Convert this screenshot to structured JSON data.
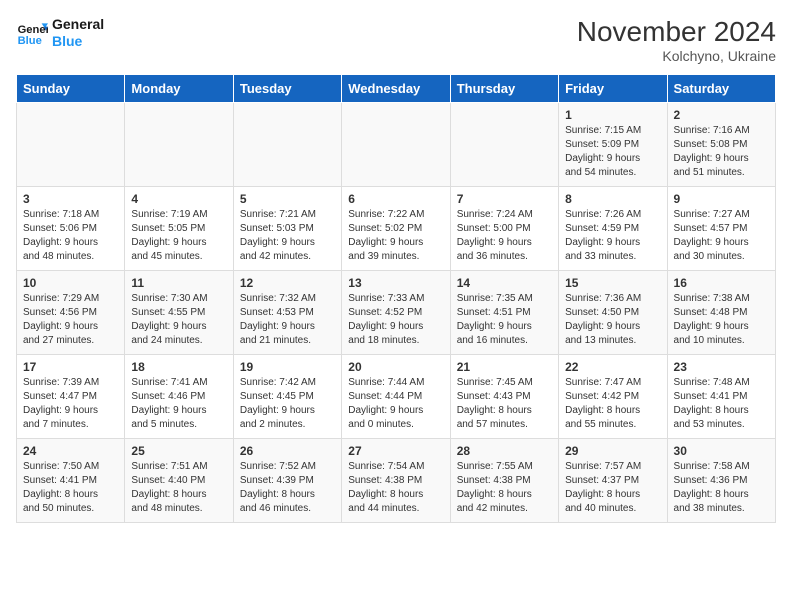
{
  "logo": {
    "line1": "General",
    "line2": "Blue"
  },
  "title": "November 2024",
  "location": "Kolchyno, Ukraine",
  "days_header": [
    "Sunday",
    "Monday",
    "Tuesday",
    "Wednesday",
    "Thursday",
    "Friday",
    "Saturday"
  ],
  "weeks": [
    [
      {
        "day": "",
        "info": ""
      },
      {
        "day": "",
        "info": ""
      },
      {
        "day": "",
        "info": ""
      },
      {
        "day": "",
        "info": ""
      },
      {
        "day": "",
        "info": ""
      },
      {
        "day": "1",
        "info": "Sunrise: 7:15 AM\nSunset: 5:09 PM\nDaylight: 9 hours\nand 54 minutes."
      },
      {
        "day": "2",
        "info": "Sunrise: 7:16 AM\nSunset: 5:08 PM\nDaylight: 9 hours\nand 51 minutes."
      }
    ],
    [
      {
        "day": "3",
        "info": "Sunrise: 7:18 AM\nSunset: 5:06 PM\nDaylight: 9 hours\nand 48 minutes."
      },
      {
        "day": "4",
        "info": "Sunrise: 7:19 AM\nSunset: 5:05 PM\nDaylight: 9 hours\nand 45 minutes."
      },
      {
        "day": "5",
        "info": "Sunrise: 7:21 AM\nSunset: 5:03 PM\nDaylight: 9 hours\nand 42 minutes."
      },
      {
        "day": "6",
        "info": "Sunrise: 7:22 AM\nSunset: 5:02 PM\nDaylight: 9 hours\nand 39 minutes."
      },
      {
        "day": "7",
        "info": "Sunrise: 7:24 AM\nSunset: 5:00 PM\nDaylight: 9 hours\nand 36 minutes."
      },
      {
        "day": "8",
        "info": "Sunrise: 7:26 AM\nSunset: 4:59 PM\nDaylight: 9 hours\nand 33 minutes."
      },
      {
        "day": "9",
        "info": "Sunrise: 7:27 AM\nSunset: 4:57 PM\nDaylight: 9 hours\nand 30 minutes."
      }
    ],
    [
      {
        "day": "10",
        "info": "Sunrise: 7:29 AM\nSunset: 4:56 PM\nDaylight: 9 hours\nand 27 minutes."
      },
      {
        "day": "11",
        "info": "Sunrise: 7:30 AM\nSunset: 4:55 PM\nDaylight: 9 hours\nand 24 minutes."
      },
      {
        "day": "12",
        "info": "Sunrise: 7:32 AM\nSunset: 4:53 PM\nDaylight: 9 hours\nand 21 minutes."
      },
      {
        "day": "13",
        "info": "Sunrise: 7:33 AM\nSunset: 4:52 PM\nDaylight: 9 hours\nand 18 minutes."
      },
      {
        "day": "14",
        "info": "Sunrise: 7:35 AM\nSunset: 4:51 PM\nDaylight: 9 hours\nand 16 minutes."
      },
      {
        "day": "15",
        "info": "Sunrise: 7:36 AM\nSunset: 4:50 PM\nDaylight: 9 hours\nand 13 minutes."
      },
      {
        "day": "16",
        "info": "Sunrise: 7:38 AM\nSunset: 4:48 PM\nDaylight: 9 hours\nand 10 minutes."
      }
    ],
    [
      {
        "day": "17",
        "info": "Sunrise: 7:39 AM\nSunset: 4:47 PM\nDaylight: 9 hours\nand 7 minutes."
      },
      {
        "day": "18",
        "info": "Sunrise: 7:41 AM\nSunset: 4:46 PM\nDaylight: 9 hours\nand 5 minutes."
      },
      {
        "day": "19",
        "info": "Sunrise: 7:42 AM\nSunset: 4:45 PM\nDaylight: 9 hours\nand 2 minutes."
      },
      {
        "day": "20",
        "info": "Sunrise: 7:44 AM\nSunset: 4:44 PM\nDaylight: 9 hours\nand 0 minutes."
      },
      {
        "day": "21",
        "info": "Sunrise: 7:45 AM\nSunset: 4:43 PM\nDaylight: 8 hours\nand 57 minutes."
      },
      {
        "day": "22",
        "info": "Sunrise: 7:47 AM\nSunset: 4:42 PM\nDaylight: 8 hours\nand 55 minutes."
      },
      {
        "day": "23",
        "info": "Sunrise: 7:48 AM\nSunset: 4:41 PM\nDaylight: 8 hours\nand 53 minutes."
      }
    ],
    [
      {
        "day": "24",
        "info": "Sunrise: 7:50 AM\nSunset: 4:41 PM\nDaylight: 8 hours\nand 50 minutes."
      },
      {
        "day": "25",
        "info": "Sunrise: 7:51 AM\nSunset: 4:40 PM\nDaylight: 8 hours\nand 48 minutes."
      },
      {
        "day": "26",
        "info": "Sunrise: 7:52 AM\nSunset: 4:39 PM\nDaylight: 8 hours\nand 46 minutes."
      },
      {
        "day": "27",
        "info": "Sunrise: 7:54 AM\nSunset: 4:38 PM\nDaylight: 8 hours\nand 44 minutes."
      },
      {
        "day": "28",
        "info": "Sunrise: 7:55 AM\nSunset: 4:38 PM\nDaylight: 8 hours\nand 42 minutes."
      },
      {
        "day": "29",
        "info": "Sunrise: 7:57 AM\nSunset: 4:37 PM\nDaylight: 8 hours\nand 40 minutes."
      },
      {
        "day": "30",
        "info": "Sunrise: 7:58 AM\nSunset: 4:36 PM\nDaylight: 8 hours\nand 38 minutes."
      }
    ]
  ]
}
